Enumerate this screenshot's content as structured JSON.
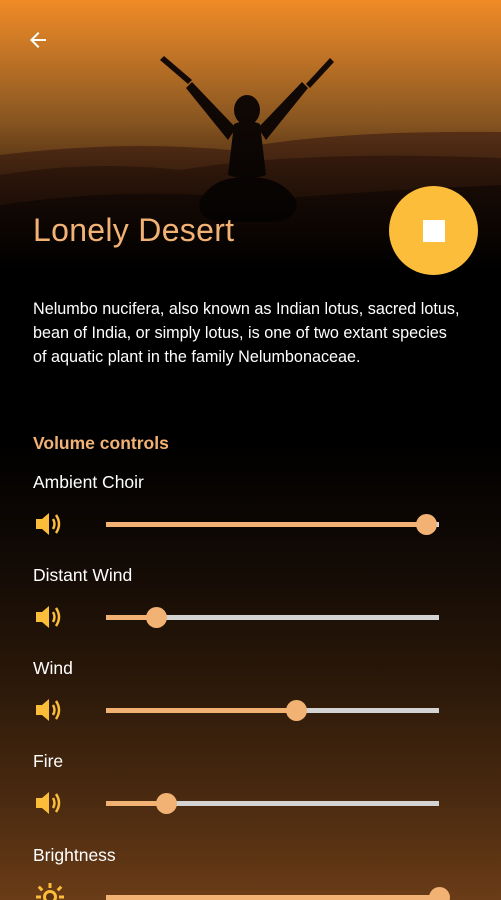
{
  "header": {
    "title": "Lonely Desert",
    "back_icon": "arrow-left-icon",
    "play_state_icon": "stop-icon"
  },
  "description": "Nelumbo nucifera, also known as Indian lotus, sacred lotus, bean of India, or simply lotus, is one of two extant species of aquatic plant in the family Nelumbonaceae.",
  "volume": {
    "section_title": "Volume controls",
    "controls": [
      {
        "label": "Ambient Choir",
        "icon": "speaker-icon",
        "level": 0.96
      },
      {
        "label": "Distant Wind",
        "icon": "speaker-icon",
        "level": 0.15
      },
      {
        "label": "Wind",
        "icon": "speaker-icon",
        "level": 0.57
      },
      {
        "label": "Fire",
        "icon": "speaker-icon",
        "level": 0.18
      },
      {
        "label": "Brightness",
        "icon": "brightness-icon",
        "level": 1.0
      }
    ]
  },
  "colors": {
    "accent": "#f2b274",
    "play_button": "#fcbd3a",
    "icon": "#fcbd3a",
    "track": "#d3d3d3"
  }
}
